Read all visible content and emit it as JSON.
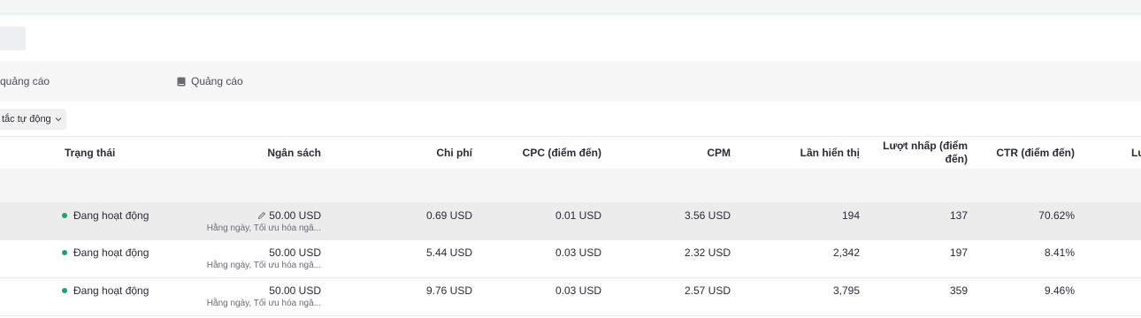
{
  "tabs": {
    "campaign_partial": "quảng cáo",
    "ad": "Quảng cáo"
  },
  "filter": {
    "label": "tắc tự động"
  },
  "columns": {
    "status": "Trạng thái",
    "budget": "Ngân sách",
    "cost": "Chi phí",
    "cpc": "CPC (điểm đến)",
    "cpm": "CPM",
    "impressions": "Lần hiển thị",
    "clicks_line1": "Lượt nhấp (điểm",
    "clicks_line2": "đến)",
    "ctr": "CTR (điểm đến)",
    "next_partial": "Lu"
  },
  "rows": [
    {
      "status": "Đang hoạt động",
      "budget": "50.00 USD",
      "budget_sub": "Hằng ngày, Tối ưu hóa ngâ...",
      "cost": "0.69 USD",
      "cpc": "0.01 USD",
      "cpm": "3.56 USD",
      "impressions": "194",
      "clicks": "137",
      "ctr": "70.62%"
    },
    {
      "status": "Đang hoạt động",
      "budget": "50.00 USD",
      "budget_sub": "Hằng ngày, Tối ưu hóa ngâ...",
      "cost": "5.44 USD",
      "cpc": "0.03 USD",
      "cpm": "2.32 USD",
      "impressions": "2,342",
      "clicks": "197",
      "ctr": "8.41%"
    },
    {
      "status": "Đang hoạt động",
      "budget": "50.00 USD",
      "budget_sub": "Hằng ngày, Tối ưu hóa ngâ...",
      "cost": "9.76 USD",
      "cpc": "0.03 USD",
      "cpm": "2.57 USD",
      "impressions": "3,795",
      "clicks": "359",
      "ctr": "9.46%"
    }
  ],
  "icons": {
    "ad_tab": "document-icon",
    "filter": "chevron-down-icon",
    "edit": "pencil-icon",
    "status": "status-dot"
  },
  "colors": {
    "status_active": "#1fa16a",
    "row_highlight": "#ececed"
  }
}
